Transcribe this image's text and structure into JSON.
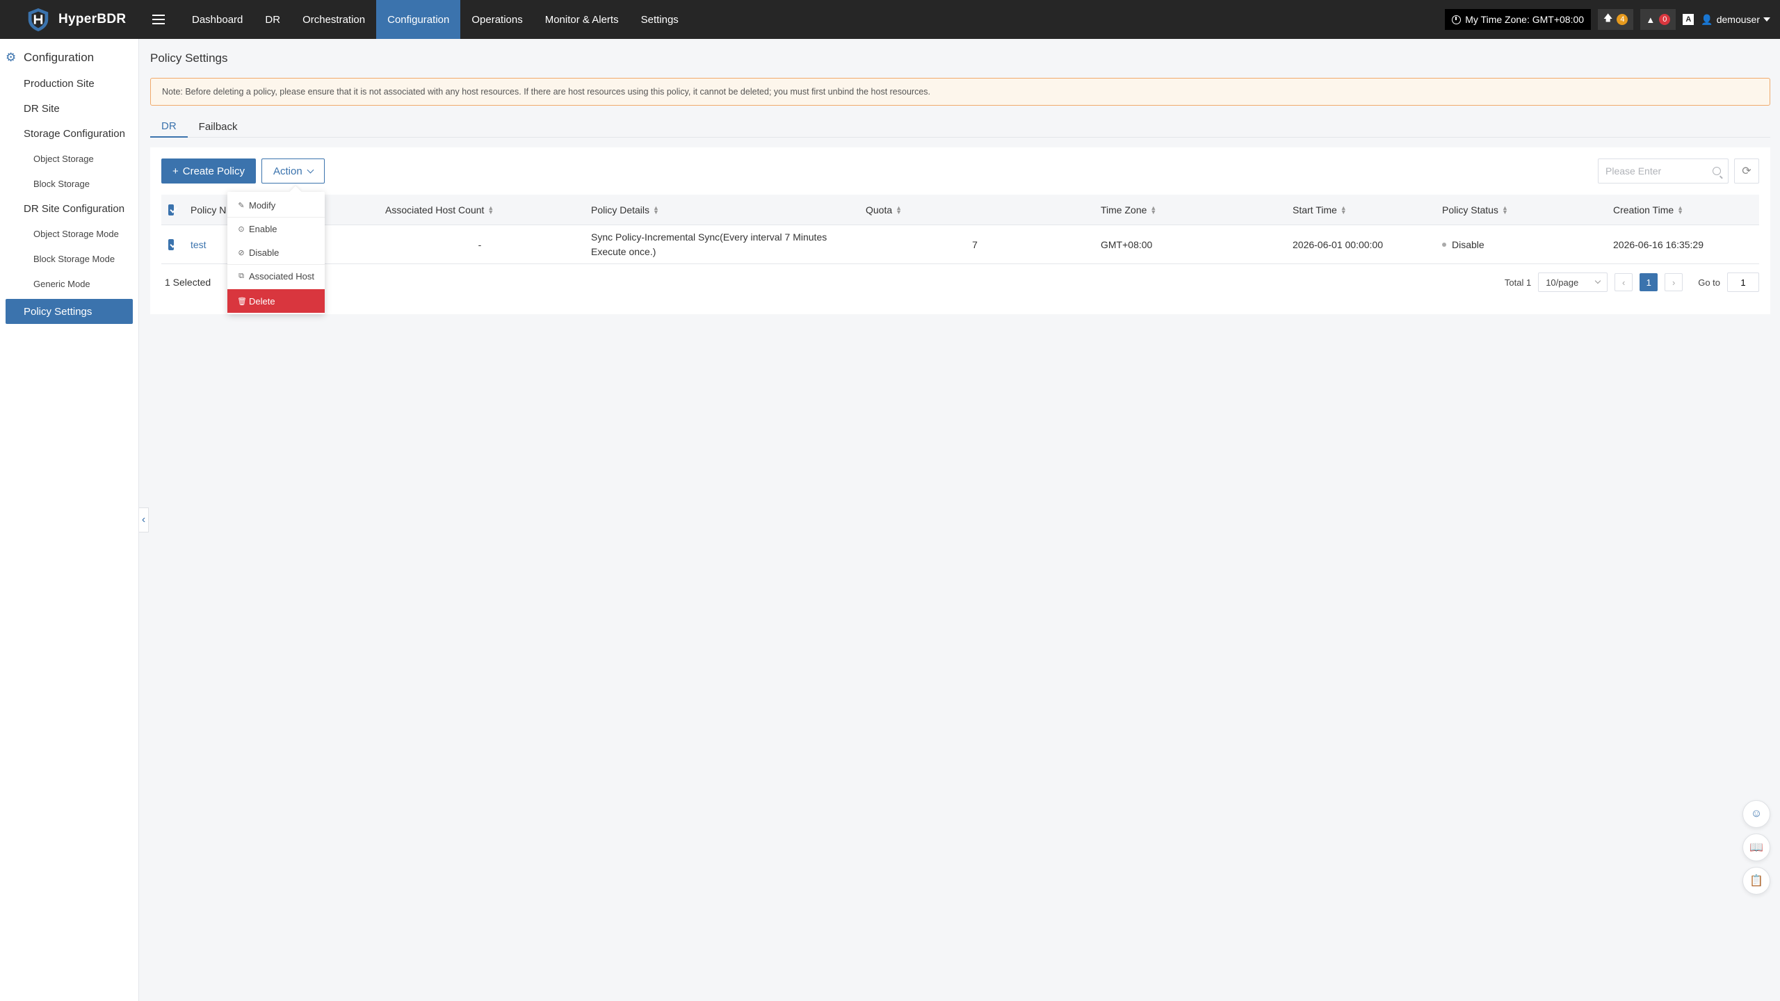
{
  "app": {
    "name": "HyperBDR"
  },
  "nav": [
    {
      "label": "Dashboard",
      "active": false
    },
    {
      "label": "DR",
      "active": false
    },
    {
      "label": "Orchestration",
      "active": false
    },
    {
      "label": "Configuration",
      "active": true
    },
    {
      "label": "Operations",
      "active": false
    },
    {
      "label": "Monitor & Alerts",
      "active": false
    },
    {
      "label": "Settings",
      "active": false
    }
  ],
  "topright": {
    "timezone": "My Time Zone: GMT+08:00",
    "upgrade_count": "4",
    "alert_count": "0",
    "user": "demouser"
  },
  "sidebar": {
    "title": "Configuration",
    "items": {
      "production_site": "Production Site",
      "dr_site": "DR Site",
      "storage_configuration": "Storage Configuration",
      "object_storage": "Object Storage",
      "block_storage": "Block Storage",
      "dr_site_configuration": "DR Site Configuration",
      "object_storage_mode": "Object Storage Mode",
      "block_storage_mode": "Block Storage Mode",
      "generic_mode": "Generic Mode",
      "policy_settings": "Policy Settings"
    }
  },
  "page": {
    "title": "Policy Settings",
    "note": "Note: Before deleting a policy, please ensure that it is not associated with any host resources. If there are host resources using this policy, it cannot be deleted; you must first unbind the host resources.",
    "tabs": {
      "dr": "DR",
      "failback": "Failback"
    }
  },
  "toolbar": {
    "create": "Create Policy",
    "action": "Action",
    "search_placeholder": "Please Enter"
  },
  "table": {
    "headers": {
      "policy_name": "Policy N",
      "associated_host_count": "Associated Host Count",
      "policy_details": "Policy Details",
      "quota": "Quota",
      "time_zone": "Time Zone",
      "start_time": "Start Time",
      "policy_status": "Policy Status",
      "creation_time": "Creation Time"
    },
    "rows": [
      {
        "policy_name": "test",
        "associated_host_count": "-",
        "policy_details_line1": "Sync Policy-Incremental Sync(Every interval 7 Minutes",
        "policy_details_line2": "Execute once.)",
        "quota": "7",
        "time_zone": "GMT+08:00",
        "start_time": "2026-06-01 00:00:00",
        "policy_status": "Disable",
        "creation_time": "2026-06-16 16:35:29"
      }
    ]
  },
  "footer": {
    "selected": "1 Selected",
    "total": "Total 1",
    "page_size": "10/page",
    "current_page": "1",
    "goto_label": "Go to",
    "goto_value": "1"
  },
  "dropdown": {
    "modify": "Modify",
    "enable": "Enable",
    "disable": "Disable",
    "associated_host": "Associated Host",
    "delete": "Delete"
  },
  "colors": {
    "accent": "#3b73ad",
    "danger": "#d9363e",
    "topbar": "#262626",
    "warning_border": "#f0a96b"
  }
}
